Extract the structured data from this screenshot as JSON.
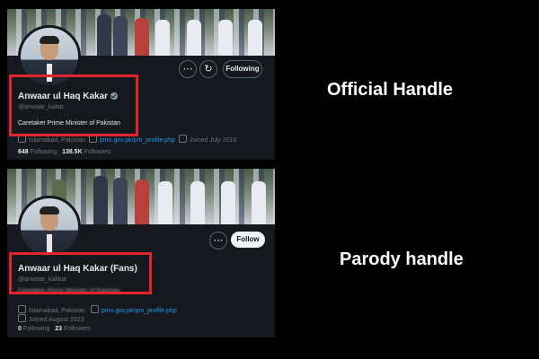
{
  "official": {
    "name": "Anwaar ul Haq Kakar",
    "handle": "@anwaar_kakar",
    "bio": "Caretaker Prime Minister of Pakistan",
    "location": "Islamabad, Pakistan",
    "website": "pmo.gov.pk/pm_profile.php",
    "joined": "Joined July 2016",
    "following_count": "648",
    "following_label": "Following",
    "followers_count": "138.5K",
    "followers_label": "Followers",
    "action_label": "Following",
    "verified": true
  },
  "parody": {
    "name": "Anwaar ul Haq Kakar (Fans)",
    "handle": "@anwaar_kakkar",
    "bio": "Caretaker Prime Minister of Pakistan",
    "location": "Islamabad, Pakistan",
    "website": "pmo.gov.pk/pm_profile.php",
    "joined": "Joined August 2023",
    "following_count": "0",
    "following_label": "Following",
    "followers_count": "23",
    "followers_label": "Followers",
    "action_label": "Follow"
  },
  "labels": {
    "official": "Official Handle",
    "parody": "Parody handle"
  },
  "icons": {
    "more": "more-icon",
    "notify": "notify-icon",
    "verified": "verified-badge-icon"
  },
  "colors": {
    "highlight": "#e0252d",
    "background": "#000000",
    "card": "#15181c",
    "link": "#1d9bf0"
  }
}
